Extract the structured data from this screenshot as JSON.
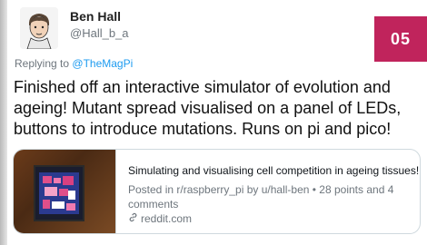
{
  "tweet": {
    "author_name": "Ben Hall",
    "author_handle": "@Hall_b_a",
    "reply_prefix": "Replying to",
    "reply_to": "@TheMagPi",
    "text": "Finished off an interactive simulator of evolution and ageing! Mutant spread visualised on a panel of LEDs, buttons to introduce mutations. Runs on pi and pico!"
  },
  "badge": {
    "number": "05",
    "color": "#c0245c"
  },
  "link_card": {
    "title": "Simulating and visualising cell competition in ageing tissues!",
    "description": "Posted in r/raspberry_pi by u/hall-ben • 28 points and 4 comments",
    "source": "reddit.com",
    "source_icon": "link-icon"
  },
  "colors": {
    "mention": "#1d9bf0",
    "secondary_text": "#6e767d",
    "border": "#cfd9de"
  }
}
